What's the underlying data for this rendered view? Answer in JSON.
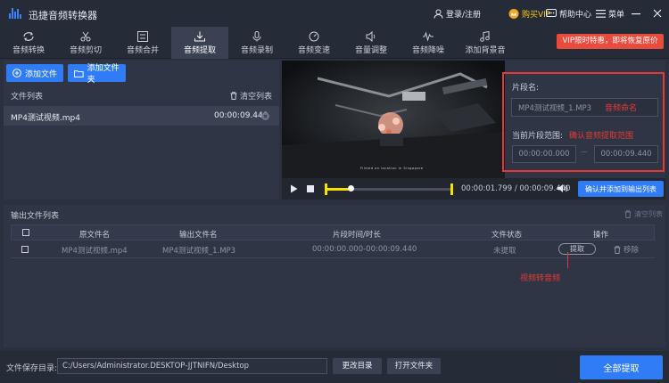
{
  "app": {
    "title": "迅捷音频转换器"
  },
  "titlebar": {
    "login": "登录/注册",
    "vip": "购买VIP",
    "help": "帮助中心",
    "menu": "菜单"
  },
  "tabs": [
    {
      "label": "音频转换",
      "icon": "convert-icon"
    },
    {
      "label": "音频剪切",
      "icon": "scissors-icon"
    },
    {
      "label": "音频合并",
      "icon": "merge-icon"
    },
    {
      "label": "音频提取",
      "icon": "extract-icon",
      "active": true
    },
    {
      "label": "音频录制",
      "icon": "record-icon"
    },
    {
      "label": "音频变速",
      "icon": "speed-icon"
    },
    {
      "label": "音量调整",
      "icon": "volume-icon"
    },
    {
      "label": "音频降噪",
      "icon": "denoise-icon"
    },
    {
      "label": "添加背景音",
      "icon": "bg-music-icon"
    }
  ],
  "promo": "VIP限时特惠，即将恢复原价",
  "left": {
    "add_file": "添加文件",
    "add_folder": "添加文件夹",
    "file_list": "文件列表",
    "clear_list": "清空列表",
    "file": {
      "name": "MP4测试视频.mp4",
      "duration": "00:00:09.440"
    }
  },
  "video": {
    "caption": "Filmed on location in Singapore"
  },
  "player": {
    "current": "00:00:01.799",
    "separator": "/",
    "total": "00:00:09.440",
    "confirm": "确认并添加到输出列表",
    "progress": 0.19
  },
  "segment": {
    "name_label": "片段名:",
    "name_value": "MP4测试视频_1.MP3",
    "name_note": "音频命名",
    "range_label": "当前片段范围:",
    "range_note": "确认音频提取范围",
    "start": "00:00:00.000",
    "dash": "—",
    "end": "00:00:09.440"
  },
  "output": {
    "title": "输出文件列表",
    "clear": "清空列表",
    "headers": [
      "原文件名",
      "输出文件名",
      "片段时间/时长",
      "文件状态",
      "操作"
    ],
    "row": {
      "src": "MP4测试视频.mp4",
      "out": "MP4测试视频_1.MP3",
      "time": "00:00:00.000-00:00:09.440",
      "status": "未提取",
      "extract": "提取",
      "remove": "移除"
    },
    "annotation": "视频转音频"
  },
  "bottom": {
    "save_label": "文件保存目录:",
    "path": "C:/Users/Administrator.DESKTOP-JJTNIFN/Desktop",
    "change_dir": "更改目录",
    "open_folder": "打开文件夹",
    "extract_all": "全部提取"
  }
}
